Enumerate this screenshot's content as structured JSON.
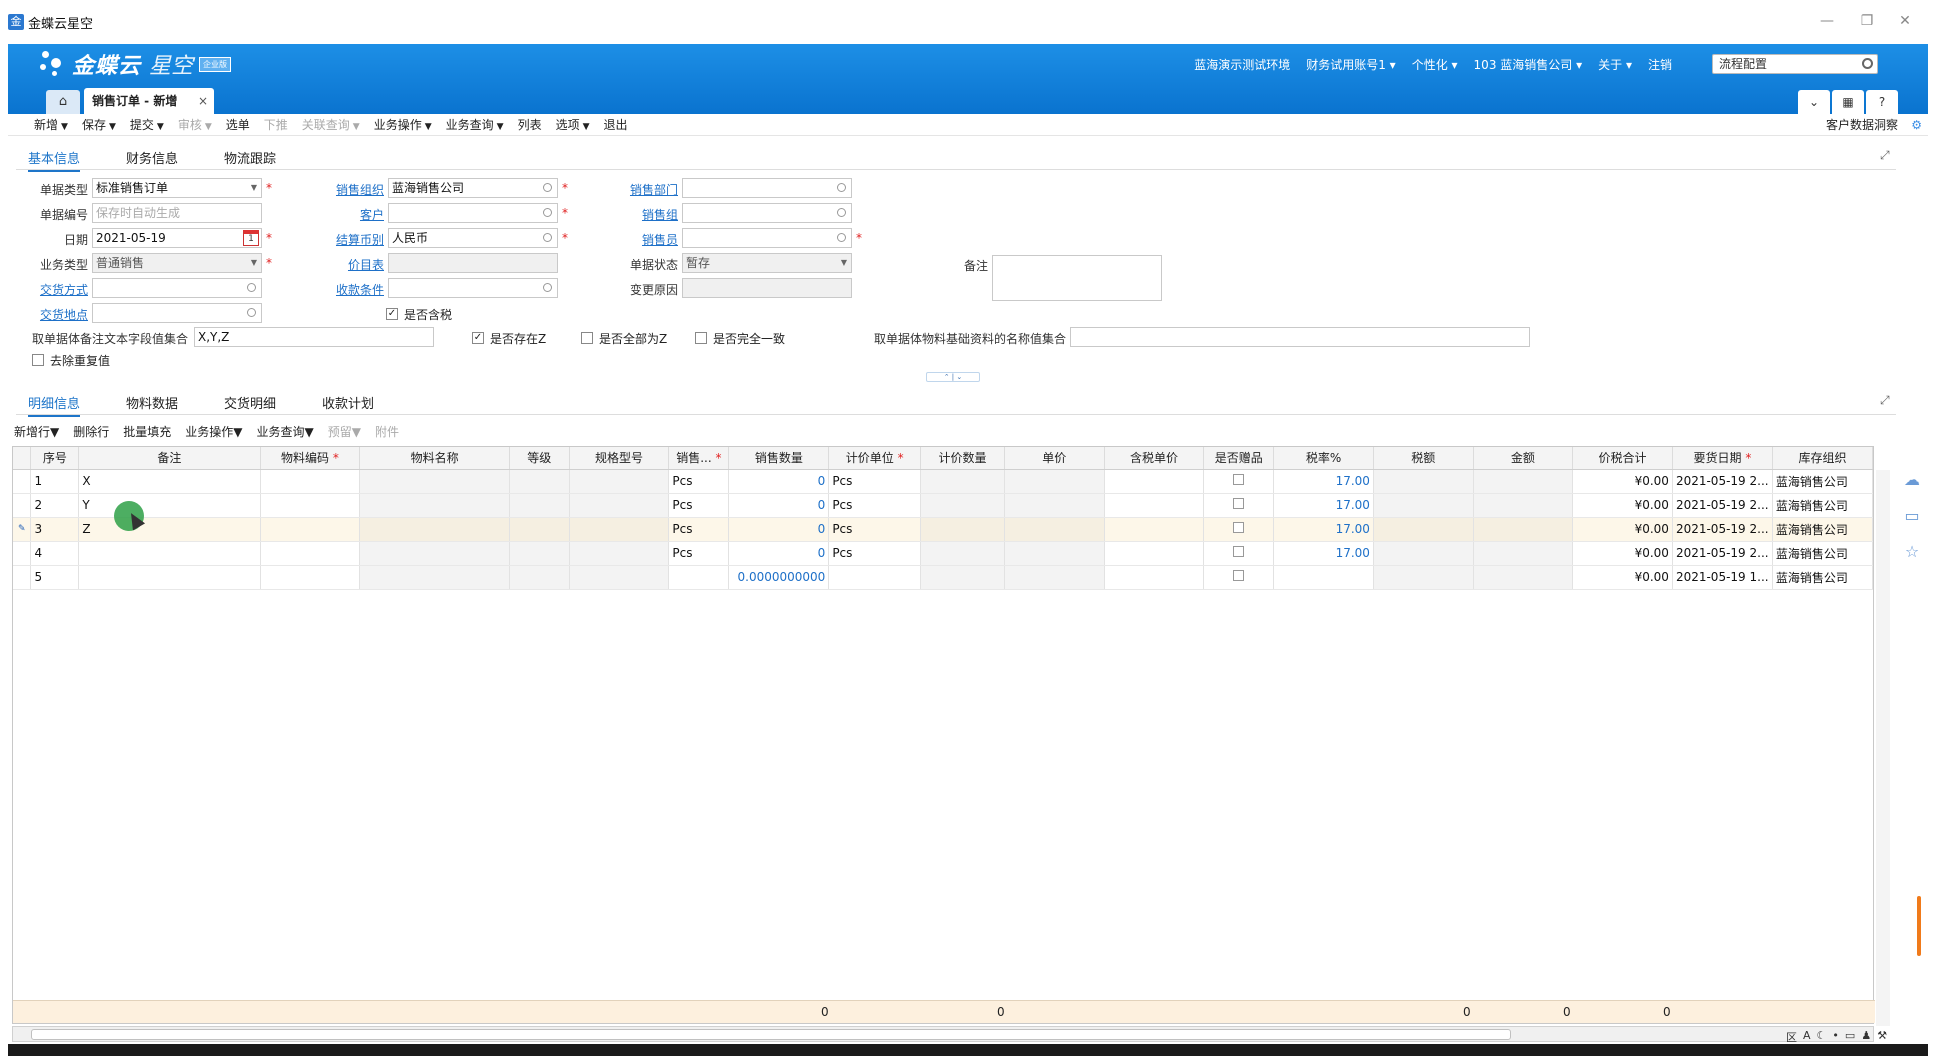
{
  "window": {
    "title": "金蝶云星空",
    "minimize": "—",
    "restore": "❐",
    "close": "✕"
  },
  "brand": {
    "name": "金蝶云",
    "product": "星空",
    "edition": "企业版"
  },
  "topmenu": {
    "env": "蓝海演示测试环境",
    "account": "财务试用账号1",
    "personalize": "个性化",
    "org": "103  蓝海销售公司",
    "about": "关于",
    "logout": "注销",
    "search_value": "流程配置"
  },
  "tabs": {
    "home_icon": "⌂",
    "doc_tab": "销售订单 - 新增",
    "close": "×"
  },
  "toolbar": {
    "items": [
      {
        "label": "新增",
        "caret": true,
        "disabled": false
      },
      {
        "label": "保存",
        "caret": true,
        "disabled": false
      },
      {
        "label": "提交",
        "caret": true,
        "disabled": false
      },
      {
        "label": "审核",
        "caret": true,
        "disabled": true
      },
      {
        "label": "选单",
        "caret": false,
        "disabled": false
      },
      {
        "label": "下推",
        "caret": false,
        "disabled": true
      },
      {
        "label": "关联查询",
        "caret": true,
        "disabled": true
      },
      {
        "label": "业务操作",
        "caret": true,
        "disabled": false
      },
      {
        "label": "业务查询",
        "caret": true,
        "disabled": false
      },
      {
        "label": "列表",
        "caret": false,
        "disabled": false
      },
      {
        "label": "选项",
        "caret": true,
        "disabled": false
      },
      {
        "label": "退出",
        "caret": false,
        "disabled": false
      }
    ],
    "right_label": "客户数据洞察"
  },
  "header_tabs": [
    "基本信息",
    "财务信息",
    "物流跟踪"
  ],
  "form": {
    "bill_type_label": "单据类型",
    "bill_type": "标准销售订单",
    "bill_no_label": "单据编号",
    "bill_no_placeholder": "保存时自动生成",
    "date_label": "日期",
    "date": "2021-05-19",
    "biz_type_label": "业务类型",
    "biz_type": "普通销售",
    "delivery_method_label": "交货方式",
    "delivery_place_label": "交货地点",
    "sale_org_label": "销售组织",
    "sale_org": "蓝海销售公司",
    "customer_label": "客户",
    "currency_label": "结算币别",
    "currency": "人民币",
    "price_list_label": "价目表",
    "receipt_terms_label": "收款条件",
    "tax_included_label": "是否含税",
    "sale_dept_label": "销售部门",
    "sale_group_label": "销售组",
    "salesman_label": "销售员",
    "status_label": "单据状态",
    "status": "暂存",
    "change_reason_label": "变更原因",
    "remark_label": "备注",
    "collect_text_label": "取单据体备注文本字段值集合",
    "collect_text": "X,Y,Z",
    "exists_z_label": "是否存在Z",
    "all_z_label": "是否全部为Z",
    "all_same_label": "是否完全一致",
    "collect_material_label": "取单据体物料基础资料的名称值集合",
    "dedupe_label": "去除重复值"
  },
  "detail_tabs": [
    "明细信息",
    "物料数据",
    "交货明细",
    "收款计划"
  ],
  "gridbar": {
    "items": [
      {
        "label": "新增行",
        "caret": true,
        "disabled": false
      },
      {
        "label": "删除行",
        "caret": false,
        "disabled": false
      },
      {
        "label": "批量填充",
        "caret": false,
        "disabled": false
      },
      {
        "label": "业务操作",
        "caret": true,
        "disabled": false
      },
      {
        "label": "业务查询",
        "caret": true,
        "disabled": false
      },
      {
        "label": "预留",
        "caret": true,
        "disabled": true
      },
      {
        "label": "附件",
        "caret": false,
        "disabled": true
      }
    ]
  },
  "grid": {
    "columns": [
      "",
      "序号",
      "备注",
      "物料编码",
      "物料名称",
      "等级",
      "规格型号",
      "销售...",
      "销售数量",
      "计价单位",
      "计价数量",
      "单价",
      "含税单价",
      "是否赠品",
      "税率%",
      "税额",
      "金额",
      "价税合计",
      "要货日期",
      "库存组织"
    ],
    "required": [
      "物料编码",
      "销售...",
      "计价单位",
      "要货日期"
    ],
    "rows": [
      {
        "seq": "1",
        "remark": "X",
        "unit": "Pcs",
        "qty": "0",
        "price_unit": "Pcs",
        "tax_rate": "17.00",
        "total": "¥0.00",
        "date": "2021-05-19 2...",
        "org": "蓝海销售公司"
      },
      {
        "seq": "2",
        "remark": "Y",
        "unit": "Pcs",
        "qty": "0",
        "price_unit": "Pcs",
        "tax_rate": "17.00",
        "total": "¥0.00",
        "date": "2021-05-19 2...",
        "org": "蓝海销售公司"
      },
      {
        "seq": "3",
        "remark": "Z",
        "unit": "Pcs",
        "qty": "0",
        "price_unit": "Pcs",
        "tax_rate": "17.00",
        "total": "¥0.00",
        "date": "2021-05-19 2...",
        "org": "蓝海销售公司"
      },
      {
        "seq": "4",
        "remark": "",
        "unit": "Pcs",
        "qty": "0",
        "price_unit": "Pcs",
        "tax_rate": "17.00",
        "total": "¥0.00",
        "date": "2021-05-19 2...",
        "org": "蓝海销售公司"
      },
      {
        "seq": "5",
        "remark": "",
        "unit": "",
        "qty": "0.0000000000",
        "price_unit": "",
        "tax_rate": "",
        "total": "¥0.00",
        "date": "2021-05-19 1...",
        "org": "蓝海销售公司"
      }
    ],
    "totals": {
      "qty": "0",
      "price_qty": "0",
      "tax": "0",
      "amount": "0",
      "total": "0"
    }
  },
  "icons": {
    "search": "search-icon",
    "calendar": "calendar-icon",
    "expand": "expand-icon",
    "cloud": "cloud-icon",
    "chat": "chat-icon",
    "star": "star-icon",
    "gear": "gear-icon"
  },
  "colors": {
    "header_blue": "#0a73cf",
    "link_blue": "#1e70c8",
    "required_red": "#e02020",
    "totals_bg": "#fdf0de"
  }
}
